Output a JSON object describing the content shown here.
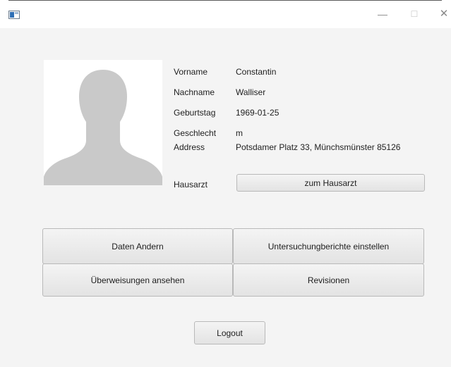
{
  "window": {
    "minimize": "—",
    "maximize": "☐",
    "close": "✕"
  },
  "patient": {
    "fields": [
      {
        "label": "Vorname",
        "value": "Constantin"
      },
      {
        "label": "Nachname",
        "value": "Walliser"
      },
      {
        "label": "Geburtstag",
        "value": "1969-01-25"
      },
      {
        "label": "Geschlecht",
        "value": "m"
      },
      {
        "label": "Address",
        "value": "Potsdamer Platz 33, Münchsmünster 85126"
      }
    ],
    "hausarzt_label": "Hausarzt",
    "hausarzt_button": "zum Hausarzt"
  },
  "actions": {
    "daten_andern": "Daten Andern",
    "untersuchungsberichte": "Untersuchungberichte einstellen",
    "ueberweisungen": "Überweisungen ansehen",
    "revisionen": "Revisionen"
  },
  "logout": "Logout"
}
